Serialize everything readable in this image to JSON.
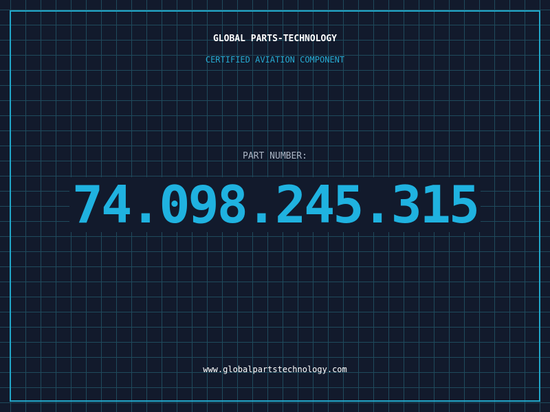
{
  "header": {
    "brand": "GLOBAL PARTS-TECHNOLOGY",
    "subtitle": "CERTIFIED AVIATION COMPONENT"
  },
  "part": {
    "label": "PART NUMBER:",
    "number": "74.098.245.315"
  },
  "footer": {
    "url": "www.globalpartstechnology.com"
  },
  "colors": {
    "background": "#121a2c",
    "grid": "#1f4a5c",
    "frame": "#22a6c8",
    "accent": "#1fb2e0",
    "label": "#aab4c4",
    "text": "#ffffff"
  }
}
